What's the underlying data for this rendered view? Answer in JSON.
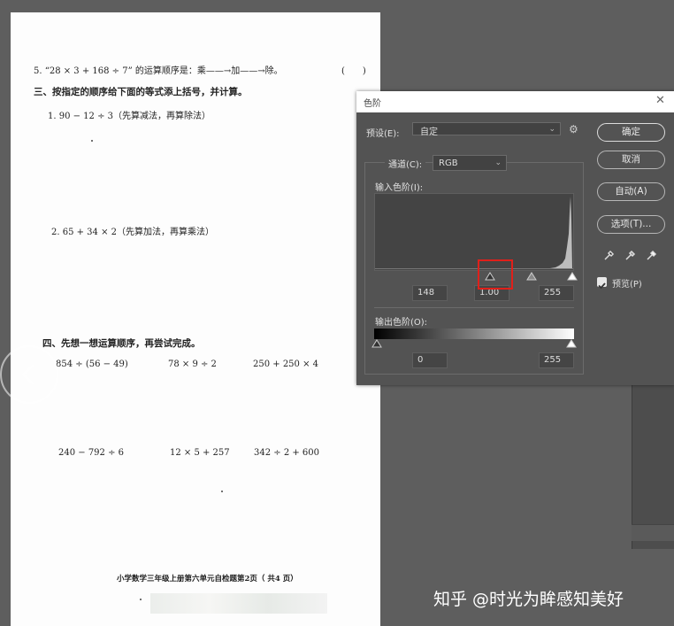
{
  "document": {
    "q5": "5. “28 × 3 + 168 ÷ 7” 的运算顺序是：乘——→加——→除。",
    "q5_paren": "(　　)",
    "section3_heading": "三、按指定的顺序给下面的等式添上括号，并计算。",
    "s3_q1": "1. 90 − 12 ÷ 3（先算减法，再算除法）",
    "s3_q2": "2. 65 + 34 × 2（先算加法，再算乘法）",
    "section4_heading": "四、先想一想运算顺序，再尝试完成。",
    "row1": [
      "854 ÷ (56 − 49)",
      "78 × 9 ÷ 2",
      "250 + 250 × 4"
    ],
    "row2": [
      "240 − 792 ÷ 6",
      "12 × 5 + 257",
      "342 ÷ 2 + 600"
    ],
    "footer": "小学数学三年级上册第六单元自检题第2页（ 共4 页）"
  },
  "dialog": {
    "title": "色阶",
    "preset_label": "预设(E):",
    "preset_value": "自定",
    "channel_label": "通道(C):",
    "channel_value": "RGB",
    "input_levels_label": "输入色阶(I):",
    "input_black": "148",
    "input_gamma": "1.00",
    "input_white": "255",
    "output_levels_label": "输出色阶(O):",
    "output_black": "0",
    "output_white": "255",
    "buttons": {
      "ok": "确定",
      "cancel": "取消",
      "auto": "自动(A)",
      "options": "选项(T)..."
    },
    "preview_label": "预览(P)",
    "highlight_color": "#e0201a"
  },
  "watermark": "知乎 @时光为眸感知美好"
}
